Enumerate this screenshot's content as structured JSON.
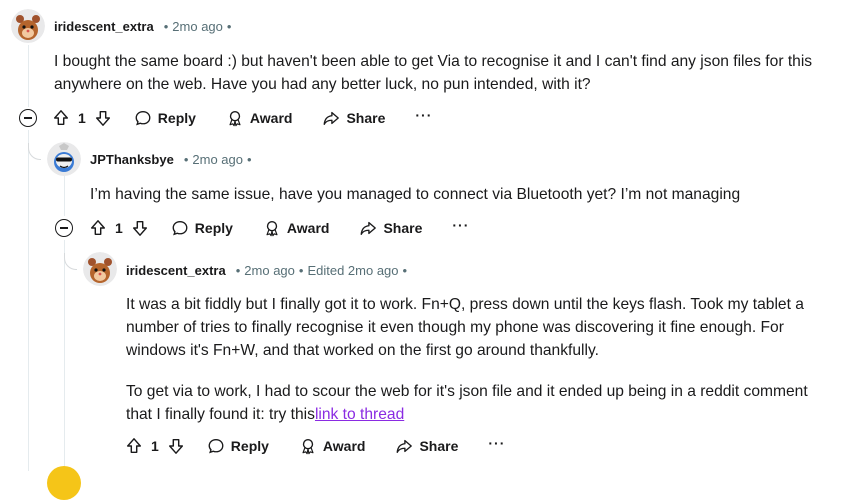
{
  "comments": [
    {
      "username": "iridescent_extra",
      "time": "2mo ago",
      "edited": "",
      "paragraphs": [
        "I bought the same board :) but haven't been able to get Via to recognise it and I can't find any json files for this anywhere on the web. Have you had any better luck, no pun intended, with it?"
      ],
      "votes": "1"
    },
    {
      "username": "JPThanksbye",
      "time": "2mo ago",
      "edited": "",
      "paragraphs": [
        "I’m having the same issue, have you managed to connect via Bluetooth yet? I’m not managing"
      ],
      "votes": "1"
    },
    {
      "username": "iridescent_extra",
      "time": "2mo ago",
      "edited": "Edited 2mo ago",
      "paragraphs": [
        "It was a bit fiddly but I finally got it to work. Fn+Q, press down until the keys flash. Took my tablet a number of tries to finally recognise it even though my phone was discovering it fine enough. For windows it's Fn+W, and that worked on the first go around thankfully.",
        "To get via to work, I had to scour the web for it's json file and it ended up being in a reddit comment that I finally found it: try this"
      ],
      "link_text": "link to thread",
      "votes": "1"
    }
  ],
  "actions": {
    "reply": "Reply",
    "award": "Award",
    "share": "Share",
    "more": "···"
  },
  "separator": "•",
  "colors": {
    "link": "#8a2be2",
    "meta": "#576f76",
    "thread_line": "#e5ebee"
  }
}
